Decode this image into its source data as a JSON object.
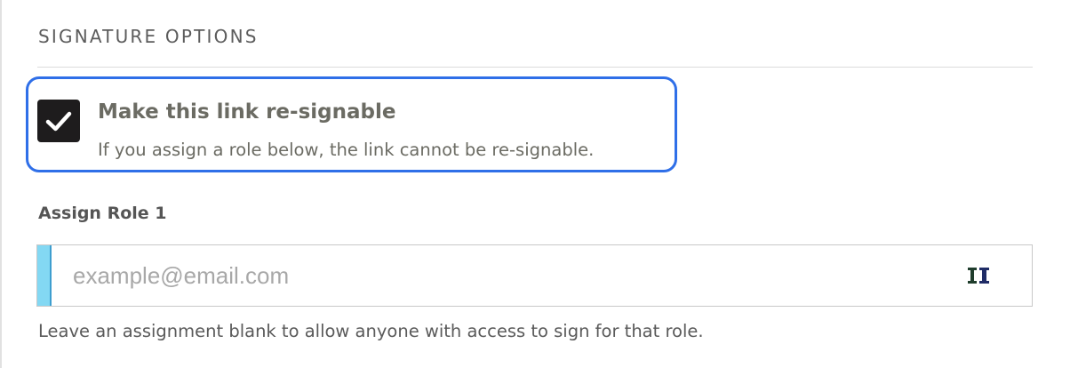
{
  "section": {
    "title": "SIGNATURE OPTIONS"
  },
  "resignable": {
    "checked": true,
    "label": "Make this link re-signable",
    "help": "If you assign a role below, the link cannot be re-signable."
  },
  "role": {
    "label": "Assign Role 1",
    "email_value": "",
    "email_placeholder": "example@email.com",
    "extension_icon": "password-manager-icon",
    "hint": "Leave an assignment blank to allow anyone with access to sign for that role."
  },
  "colors": {
    "focus_ring": "#2f6fe8",
    "checkbox": "#1e1c1d",
    "input_accent": "#83d8f3"
  }
}
